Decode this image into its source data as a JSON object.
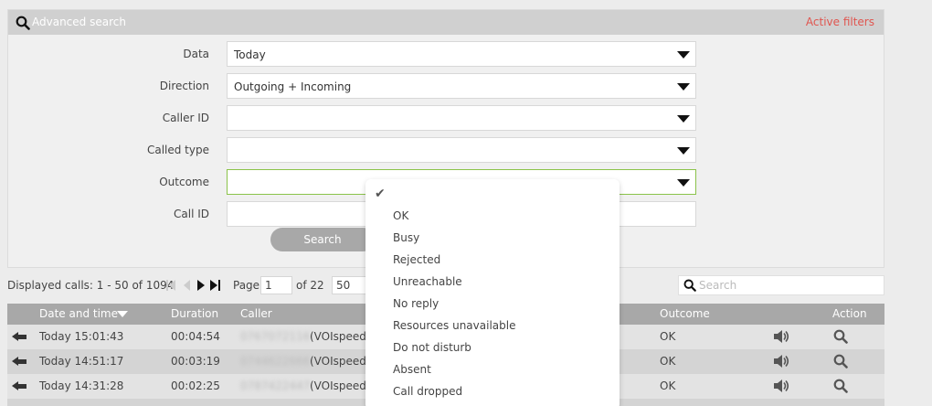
{
  "panel": {
    "title": "Advanced search",
    "active_filters": "Active filters"
  },
  "form": {
    "rows": [
      {
        "label": "Data",
        "value": "Today"
      },
      {
        "label": "Direction",
        "value": "Outgoing + Incoming"
      },
      {
        "label": "Caller ID",
        "value": ""
      },
      {
        "label": "Called type",
        "value": ""
      },
      {
        "label": "Outcome",
        "value": ""
      },
      {
        "label": "Call ID",
        "value": ""
      }
    ],
    "search_button": "Search"
  },
  "dropdown": {
    "options": [
      "OK",
      "Busy",
      "Rejected",
      "Unreachable",
      "No reply",
      "Resources unavailable",
      "Do not disturb",
      "Absent",
      "Call dropped"
    ]
  },
  "pager": {
    "count_text": "Displayed calls: 1 - 50 of 1094",
    "page_label": "Page",
    "page_value": "1",
    "of_text": "of 22",
    "per_page": "50"
  },
  "table_search": {
    "placeholder": "Search"
  },
  "table": {
    "columns": [
      "Date and time",
      "Duration",
      "Caller",
      "Outcome",
      "Action"
    ],
    "rows": [
      {
        "datetime": "Today 15:01:43",
        "duration": "00:04:54",
        "caller_number": "0767072116",
        "caller_suffix": "(VOIspeed",
        "outcome": "OK"
      },
      {
        "datetime": "Today 14:51:17",
        "duration": "00:03:19",
        "caller_number": "0744622666",
        "caller_suffix": "(VOIspeed",
        "outcome": "OK"
      },
      {
        "datetime": "Today 14:31:28",
        "duration": "00:02:25",
        "caller_number": "0787422447",
        "caller_suffix": "(VOIspeed",
        "outcome": "OK"
      }
    ]
  },
  "colors": {
    "accent_red": "#e0554f",
    "focus_green": "#8bc34a",
    "header_gray": "#a8a8a8"
  }
}
